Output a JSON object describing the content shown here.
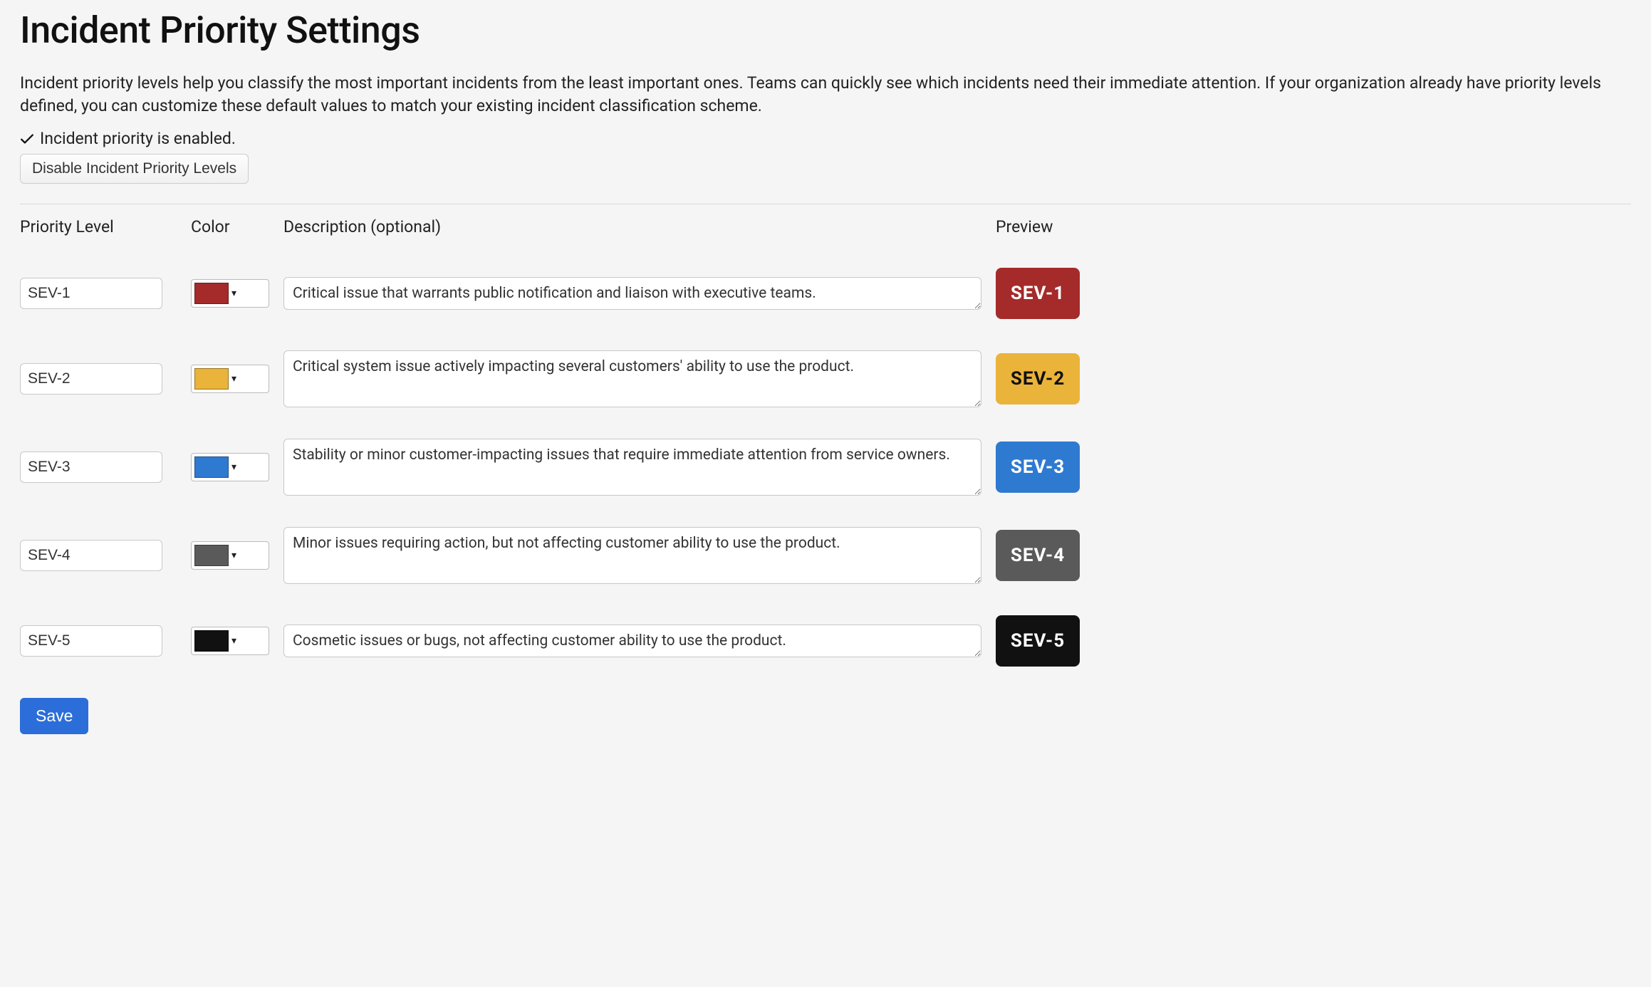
{
  "page": {
    "title": "Incident Priority Settings",
    "intro": "Incident priority levels help you classify the most important incidents from the least important ones. Teams can quickly see which incidents need their immediate attention. If your organization already have priority levels defined, you can customize these default values to match your existing incident classification scheme.",
    "status_text": "Incident priority is enabled.",
    "disable_button": "Disable Incident Priority Levels",
    "save_button": "Save"
  },
  "columns": {
    "level": "Priority Level",
    "color": "Color",
    "description": "Description (optional)",
    "preview": "Preview"
  },
  "levels": [
    {
      "name": "SEV-1",
      "color": "#a52a2a",
      "text_color": "#ffffff",
      "description": "Critical issue that warrants public notification and liaison with executive teams."
    },
    {
      "name": "SEV-2",
      "color": "#eab33a",
      "text_color": "#111111",
      "description": "Critical system issue actively impacting several customers' ability to use the product."
    },
    {
      "name": "SEV-3",
      "color": "#2f7ad1",
      "text_color": "#ffffff",
      "description": "Stability or minor customer-impacting issues that require immediate attention from service owners."
    },
    {
      "name": "SEV-4",
      "color": "#5a5a5a",
      "text_color": "#ffffff",
      "description": "Minor issues requiring action, but not affecting customer ability to use the product."
    },
    {
      "name": "SEV-5",
      "color": "#111111",
      "text_color": "#ffffff",
      "description": "Cosmetic issues or bugs, not affecting customer ability to use the product."
    }
  ]
}
